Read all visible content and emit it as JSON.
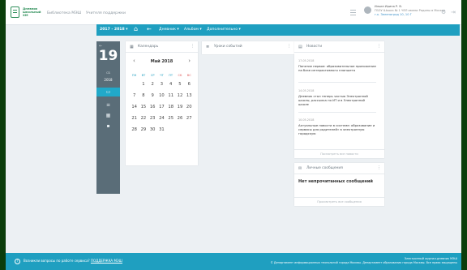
{
  "header": {
    "logo_lines": [
      "Дневник",
      "школьный",
      "ХМ"
    ],
    "nav": [
      "Библиотека МЭШ",
      "Учителя поддержки"
    ],
    "user": {
      "name": "Ильин Ирина Р. В.",
      "role": "ГБОУ Школа № 1 ЧЕЛ имени Родины в Москве",
      "link": "г.к. Зеленоград 10, 10 Г"
    }
  },
  "bluebar": {
    "year": "2017 - 2018 ▾",
    "items": [
      "Дневник ▾",
      "Альбом ▾",
      "Дополнительно ▾"
    ]
  },
  "sidebar": {
    "day": "19",
    "weekday": "СБ",
    "year": "2018",
    "buttons": [
      "▭",
      "≡",
      "▦",
      "▪"
    ]
  },
  "calendar": {
    "title": "Календарь",
    "month": "Май 2018",
    "weekdays": [
      "ПН",
      "ВТ",
      "СР",
      "ЧТ",
      "ПТ",
      "СБ",
      "ВС"
    ],
    "weeks": [
      [
        "",
        "1",
        "2",
        "3",
        "4",
        "5",
        "6"
      ],
      [
        "7",
        "8",
        "9",
        "10",
        "11",
        "12",
        "13"
      ],
      [
        "14",
        "15",
        "16",
        "17",
        "18",
        "19",
        "20"
      ],
      [
        "21",
        "22",
        "23",
        "24",
        "25",
        "26",
        "27"
      ],
      [
        "28",
        "29",
        "30",
        "31",
        "",
        "",
        ""
      ]
    ]
  },
  "lessons": {
    "title": "Уроки событий"
  },
  "news": {
    "title": "Новости",
    "items": [
      {
        "date": "17.05.2018",
        "text": "Понятие первое: образовательное приложение на базе интерактивного планшета"
      },
      {
        "date": "14.05.2018",
        "text": "Дневник стал теперь частью Электронной школы, рассылка по ИТ и в Электронной школе"
      },
      {
        "date": "10.05.2018",
        "text": "Актуальные новости в системе: образование и сервисы для родителей» в электронную городскую"
      }
    ],
    "footer": "Посмотреть все новости"
  },
  "messages": {
    "title": "Личные сообщения",
    "empty": "Нет непрочитанных сообщений",
    "footer": "Просмотреть все сообщения"
  },
  "footer": {
    "help_text": "Возникли вопросы по работе сервиса?",
    "help_link": "ПОДДЕРЖКА МЭШ",
    "right_line1": "Электронный журнал-дневник МЭШ",
    "right_line2": "© Департамент информационных технологий города Москвы. Департамент образования города Москвы. Все права защищены"
  }
}
